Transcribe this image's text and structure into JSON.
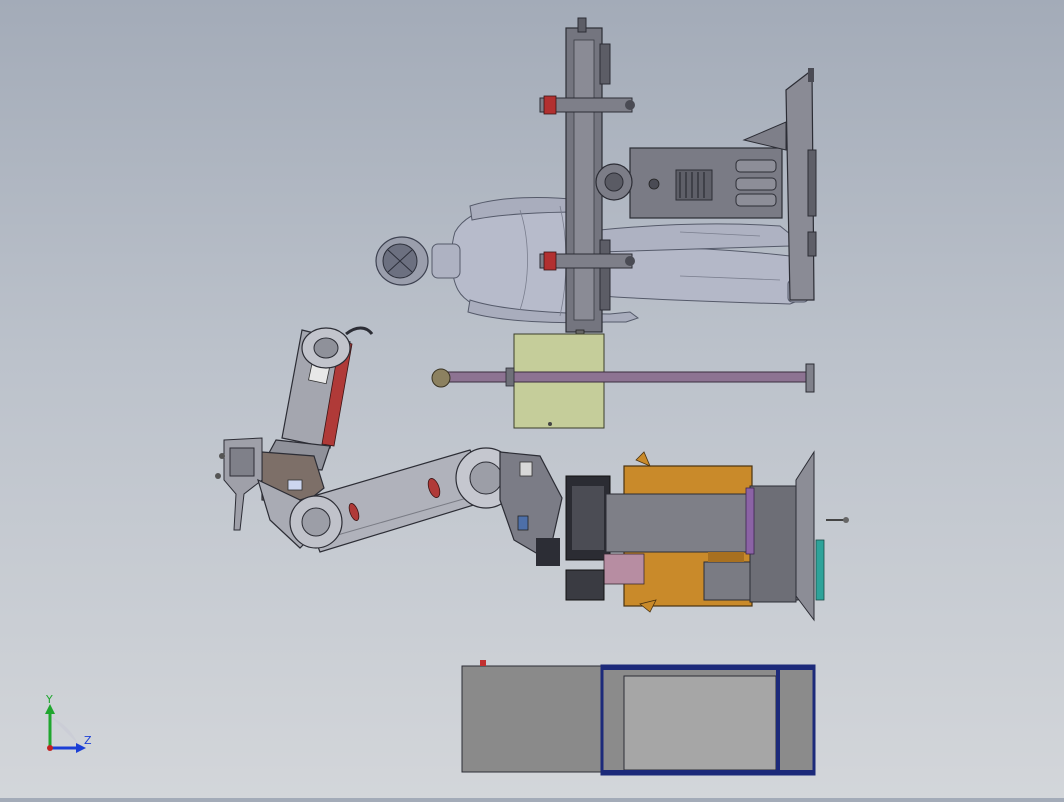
{
  "viewport": {
    "background_top": "#a3abb8",
    "background_bottom": "#d3d6da"
  },
  "triad": {
    "y_label": "Y",
    "z_label": "Z",
    "y_color": "#1fa62e",
    "z_color": "#1b3fd6",
    "x_color": "#c22222"
  },
  "colors": {
    "steel": "#6e6f78",
    "steel_light": "#9c9da7",
    "mannequin": "#b5b9c8",
    "arm": "#a7a9b2",
    "orange": "#c98a2a",
    "olive": "#c7cf9b",
    "rod": "#8a6f8f",
    "frame_blue": "#1c2a7a",
    "grey_box": "#8a8a8a"
  },
  "icons": {
    "triad": "coordinate-triad-icon"
  }
}
